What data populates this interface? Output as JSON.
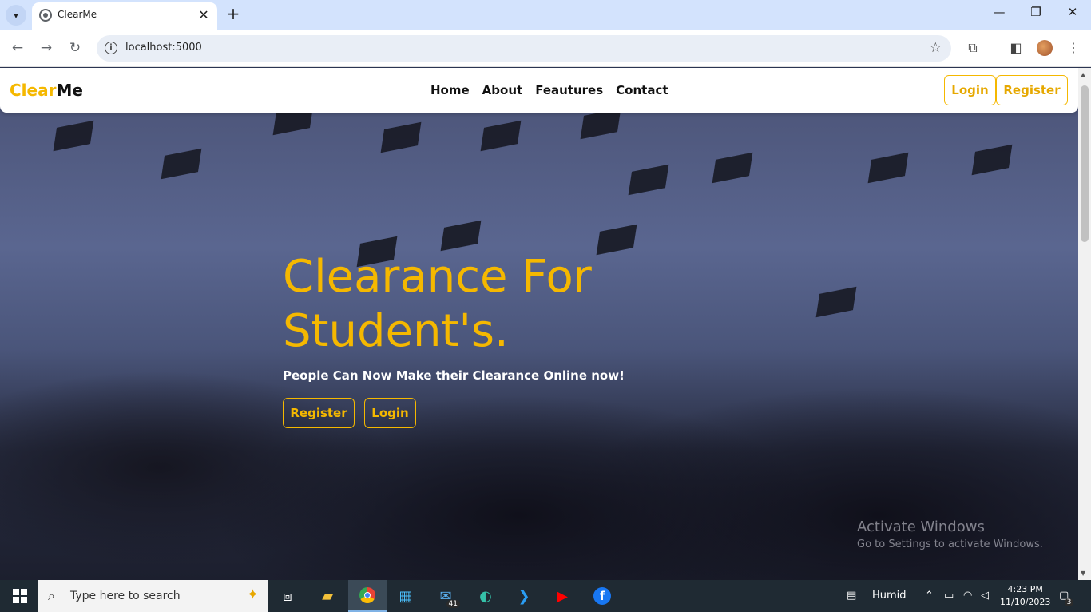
{
  "browser": {
    "tab_title": "ClearMe",
    "url": "localhost:5000"
  },
  "site": {
    "brand_part1": "Clear",
    "brand_part2": "Me",
    "nav": [
      "Home",
      "About",
      "Feautures",
      "Contact"
    ],
    "login_label": "Login",
    "register_label": "Register"
  },
  "hero": {
    "title_line1": "Clearance For",
    "title_line2": "Student's.",
    "subtitle": "People Can Now Make their Clearance Online now!",
    "register_label": "Register",
    "login_label": "Login"
  },
  "watermark": {
    "title": "Activate Windows",
    "subtitle": "Go to Settings to activate Windows."
  },
  "taskbar": {
    "search_placeholder": "Type here to search",
    "weather": "Humid",
    "time": "4:23 PM",
    "date": "11/10/2023",
    "mail_badge": "41",
    "notification_badge": "3"
  },
  "colors": {
    "accent": "#f5b800",
    "taskbar": "#1f2a33"
  }
}
